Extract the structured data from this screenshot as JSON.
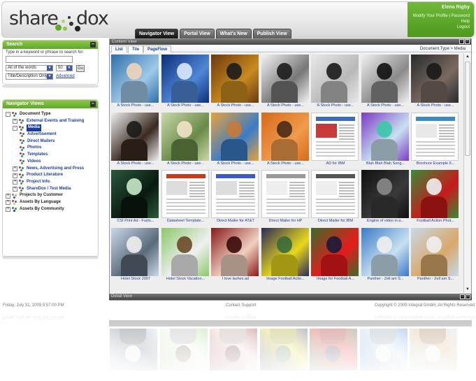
{
  "brand": {
    "logo_text_left": "share",
    "logo_text_right": "dox",
    "accent": "#5ea828"
  },
  "top_tabs": [
    {
      "label": "Navigator View",
      "active": true
    },
    {
      "label": "Portal View",
      "active": false
    },
    {
      "label": "What's New",
      "active": false
    },
    {
      "label": "Publish View",
      "active": false
    }
  ],
  "user": {
    "name": "Elena Rigby",
    "links": [
      "Modify Your Profile",
      "Password",
      "Help",
      "Logout"
    ]
  },
  "search": {
    "title": "Search",
    "prompt": "Type in a keyword or phrase to search for:",
    "input_value": "",
    "match_mode": "All of the words",
    "results_count": "50",
    "go_label": "Go",
    "scope": "Title/Description Only",
    "advanced_label": "Advanced"
  },
  "navigator": {
    "title": "Navigator Views",
    "tree": [
      {
        "label": "Document Type",
        "level": 0,
        "exp": "-",
        "icon": "group-icon"
      },
      {
        "label": "External Events and Training",
        "level": 1,
        "exp": "+",
        "icon": "category-icon"
      },
      {
        "label": "Media",
        "level": 1,
        "exp": "-",
        "icon": "category-icon",
        "selected": true
      },
      {
        "label": "Advertisement",
        "level": 2,
        "icon": "category-icon"
      },
      {
        "label": "Direct Mailers",
        "level": 2,
        "icon": "category-icon"
      },
      {
        "label": "Photos",
        "level": 2,
        "icon": "category-icon"
      },
      {
        "label": "Templates",
        "level": 2,
        "icon": "category-icon"
      },
      {
        "label": "Videos",
        "level": 2,
        "icon": "category-icon"
      },
      {
        "label": "News, Advertising and Press",
        "level": 1,
        "exp": "+",
        "icon": "category-icon"
      },
      {
        "label": "Product Literature",
        "level": 1,
        "exp": "+",
        "icon": "category-icon"
      },
      {
        "label": "Project Info.",
        "level": 1,
        "exp": "+",
        "icon": "category-icon"
      },
      {
        "label": "ShareDox / Test Media",
        "level": 1,
        "exp": "+",
        "icon": "category-icon"
      },
      {
        "label": "Projects by Customer",
        "level": 0,
        "exp": "+",
        "icon": "person-icon"
      },
      {
        "label": "Assets By Language",
        "level": 0,
        "exp": "+",
        "icon": "language-icon"
      },
      {
        "label": "Assets By Community",
        "level": 0,
        "exp": "+",
        "icon": "globe-icon"
      }
    ]
  },
  "content_view": {
    "title": "Content View",
    "tabs": [
      {
        "label": "List",
        "active": false
      },
      {
        "label": "Tile",
        "active": true
      },
      {
        "label": "PageFlow",
        "active": false
      }
    ],
    "breadcrumb": "Document Type   >   Media",
    "tiles": [
      {
        "caption": "A Stock Photo - use...",
        "thumb": "photo-man-blue",
        "colors": [
          "#2f6fa8",
          "#9fc8e8",
          "#f0d5b8"
        ]
      },
      {
        "caption": "A Stock Photo - use...",
        "thumb": "photo-world-map",
        "colors": [
          "#0d2f7a",
          "#4f86d6",
          "#dce9ff"
        ]
      },
      {
        "caption": "A Stock Photo - use...",
        "thumb": "photo-couple-laptop",
        "colors": [
          "#6b3a10",
          "#c98a1f",
          "#1b1b1b"
        ]
      },
      {
        "caption": "A Stock Photo - use...",
        "thumb": "photo-business-meeting",
        "colors": [
          "#f3f3f3",
          "#777777",
          "#1c1c1c"
        ]
      },
      {
        "caption": "A Stock Photo - use...",
        "thumb": "photo-woman-phone",
        "colors": [
          "#e8e8e8",
          "#b9b9b9",
          "#1a1a1a"
        ]
      },
      {
        "caption": "A Stock Photo - use...",
        "thumb": "photo-man-suit",
        "colors": [
          "#f0f0f0",
          "#8a8a8a",
          "#111111"
        ]
      },
      {
        "caption": "A Stock Photo - use...",
        "thumb": "photo-man-phone",
        "colors": [
          "#2a2a2a",
          "#7a6a60",
          "#1a1a1a"
        ]
      },
      {
        "caption": "A Stock Photo - use...",
        "thumb": "photo-woman-dark",
        "colors": [
          "#efefef",
          "#3a2a20",
          "#1b1b1b"
        ]
      },
      {
        "caption": "A Stock Photo - use...",
        "thumb": "photo-students",
        "colors": [
          "#c9d8a8",
          "#6a8a48",
          "#f2e2c8"
        ]
      },
      {
        "caption": "A Stock Photo - use...",
        "thumb": "photo-woman-headset",
        "colors": [
          "#e8a23a",
          "#3a7cc8",
          "#c67a3a"
        ]
      },
      {
        "caption": "A Stock Photo - use...",
        "thumb": "photo-woman-orange",
        "colors": [
          "#d66a1c",
          "#f09a4a",
          "#4a2a1a"
        ]
      },
      {
        "caption": "AD for IBM",
        "thumb": "doc-ad-ibm",
        "colors": [
          "#ffffff",
          "#3a6ac8",
          "#c83a3a"
        ]
      },
      {
        "caption": "Blah Blah Blah Song...",
        "thumb": "art-stripes",
        "colors": [
          "#7a3ac8",
          "#c8e0f0",
          "#3ac8a8"
        ]
      },
      {
        "caption": "Brochure Example II...",
        "thumb": "doc-brochure",
        "colors": [
          "#ffffff",
          "#3a8ac8",
          "#e8e8e8"
        ]
      },
      {
        "caption": "CSI Print Ad - Fuslo...",
        "thumb": "poster-csi",
        "colors": [
          "#2a5a3a",
          "#0a1a10",
          "#c8e8c8"
        ]
      },
      {
        "caption": "Datasheet Template...",
        "thumb": "doc-datasheet",
        "colors": [
          "#ffffff",
          "#c83a1a",
          "#dddddd"
        ]
      },
      {
        "caption": "Direct Mailer for AT&T",
        "thumb": "doc-mailer-att",
        "colors": [
          "#ffffff",
          "#3a5ac8",
          "#dddddd"
        ]
      },
      {
        "caption": "Direct Mailer for HP",
        "thumb": "doc-mailer-hp",
        "colors": [
          "#ffffff",
          "#999999",
          "#eeeeee"
        ]
      },
      {
        "caption": "Direct Mailer for IBM",
        "thumb": "doc-mailer-ibm",
        "colors": [
          "#ffffff",
          "#555555",
          "#eeeeee"
        ]
      },
      {
        "caption": "Engine of video in a...",
        "thumb": "photo-engine",
        "colors": [
          "#111111",
          "#3a3a3a",
          "#8a8a8a"
        ]
      },
      {
        "caption": "Football Action Phot...",
        "thumb": "photo-football",
        "colors": [
          "#3a8a3a",
          "#c81a1a",
          "#f0f0f0"
        ]
      },
      {
        "caption": "Hotel Stock 2007",
        "thumb": "photo-cablecar",
        "colors": [
          "#c8d8e8",
          "#5a6a7a",
          "#f0f0f0"
        ]
      },
      {
        "caption": "Hotel Stock Vacation...",
        "thumb": "photo-accordion",
        "colors": [
          "#8ac86a",
          "#f0f0f0",
          "#6a4a2a"
        ]
      },
      {
        "caption": "I love lashes ad",
        "thumb": "ad-lashes",
        "colors": [
          "#8a1a1a",
          "#f0d0c0",
          "#3a0a0a"
        ]
      },
      {
        "caption": "Image Football Actio...",
        "thumb": "photo-football-2",
        "colors": [
          "#2a2a5a",
          "#e8d81a",
          "#3a6a3a"
        ]
      },
      {
        "caption": "Image for Football A...",
        "thumb": "photo-football-3",
        "colors": [
          "#3a6a2a",
          "#e81a1a",
          "#1a1a3a"
        ]
      },
      {
        "caption": "Panther - Zell am S...",
        "thumb": "photo-lake",
        "colors": [
          "#3a7ac8",
          "#c8e0f0",
          "#f0f0f0"
        ]
      },
      {
        "caption": "Panther - Zell am S...",
        "thumb": "photo-woman-snow",
        "colors": [
          "#c8d8e8",
          "#d8a86a",
          "#f0f0f0"
        ]
      }
    ]
  },
  "detail_view": {
    "title": "Detail View"
  },
  "footer": {
    "date": "Friday, July 31, 2009 5:57:00 PM",
    "support": "Contact Support",
    "copyright": "Copyright © 2009 Integral GmbH, All Rights Reserved"
  }
}
